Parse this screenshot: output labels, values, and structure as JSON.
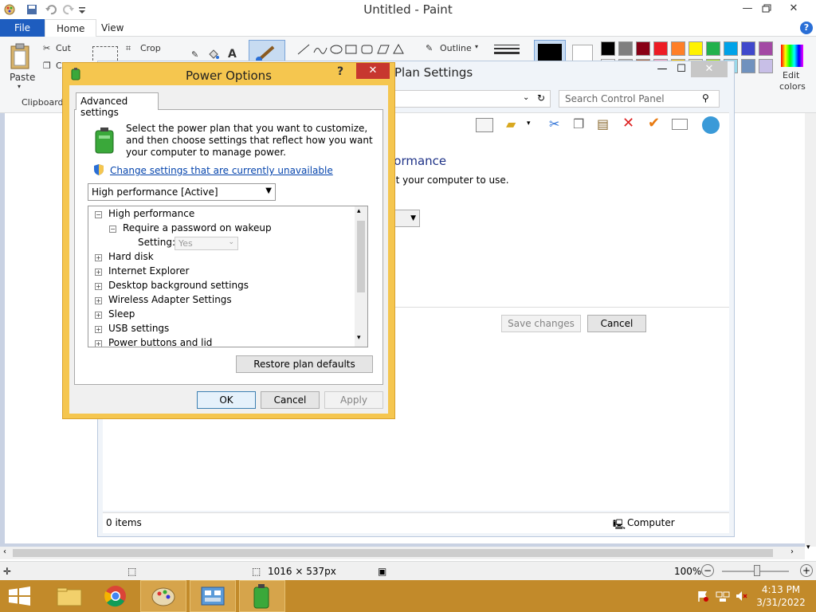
{
  "paint": {
    "title": "Untitled - Paint",
    "tabs": {
      "file": "File",
      "home": "Home",
      "view": "View"
    },
    "help": "?",
    "ribbon": {
      "paste": "Paste",
      "cut": "Cut",
      "copy": "C",
      "crop": "Crop",
      "clipboard_group": "Clipboard",
      "outline": "Outline",
      "edit_colors_line1": "Edit",
      "edit_colors_line2": "colors"
    },
    "palette_top": [
      "#000000",
      "#7f7f7f",
      "#880015",
      "#ed1c24",
      "#ff7f27",
      "#fff200",
      "#22b14c",
      "#00a2e8",
      "#3f48cc",
      "#a349a4"
    ],
    "palette_bottom": [
      "#ffffff",
      "#c3c3c3",
      "#b97a57",
      "#ffaec9",
      "#ffc90e",
      "#efe4b0",
      "#b5e61d",
      "#99d9ea",
      "#7092be",
      "#c8bfe7"
    ],
    "status": {
      "canvas_size": "1016 × 537px",
      "zoom": "100%"
    }
  },
  "control_panel": {
    "title": "Plan Settings",
    "search_placeholder": "Search Control Panel",
    "heading": "formance",
    "subtext": "nt your computer to use.",
    "save_changes": "Save changes",
    "cancel": "Cancel",
    "status_items": "0 items",
    "status_computer": "Computer"
  },
  "power_options": {
    "title": "Power Options",
    "help": "?",
    "tab": "Advanced settings",
    "intro": "Select the power plan that you want to customize, and then choose settings that reflect how you want your computer to manage power.",
    "change_link": "Change settings that are currently unavailable",
    "plan_select": "High performance [Active]",
    "tree": [
      {
        "label": "High performance",
        "toggle": "−"
      },
      {
        "label": "Require a password on wakeup",
        "toggle": "−"
      },
      {
        "label": "Hard disk",
        "toggle": "+"
      },
      {
        "label": "Internet Explorer",
        "toggle": "+"
      },
      {
        "label": "Desktop background settings",
        "toggle": "+"
      },
      {
        "label": "Wireless Adapter Settings",
        "toggle": "+"
      },
      {
        "label": "Sleep",
        "toggle": "+"
      },
      {
        "label": "USB settings",
        "toggle": "+"
      },
      {
        "label": "Power buttons and lid",
        "toggle": "+"
      }
    ],
    "setting_label": "Setting:",
    "setting_value": "Yes",
    "restore": "Restore plan defaults",
    "ok": "OK",
    "cancel": "Cancel",
    "apply": "Apply"
  },
  "taskbar": {
    "time": "4:13 PM",
    "date": "3/31/2022"
  },
  "colors": {
    "taskbar": "#c28a2a",
    "dialog_frame": "#f5c64f",
    "file_tab": "#1e5dbf",
    "close_red": "#c7372f",
    "link": "#0645ad"
  }
}
